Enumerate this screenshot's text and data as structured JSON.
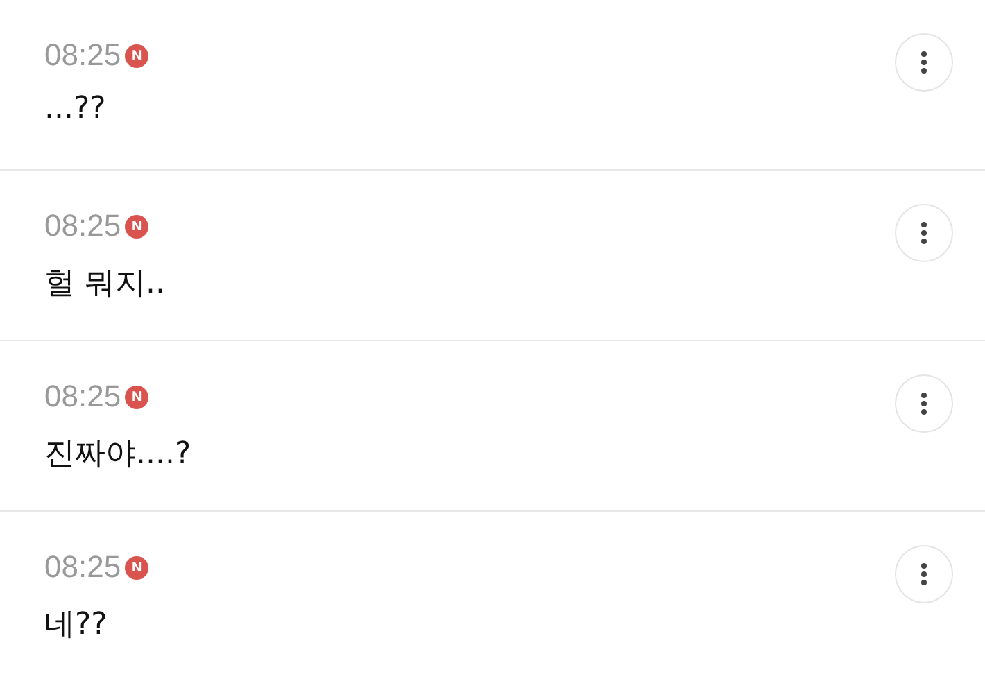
{
  "comments": [
    {
      "time": "08:25",
      "badge": "N",
      "text": "...??"
    },
    {
      "time": "08:25",
      "badge": "N",
      "text": "헐 뭐지.."
    },
    {
      "time": "08:25",
      "badge": "N",
      "text": "진짜야....?"
    },
    {
      "time": "08:25",
      "badge": "N",
      "text": "네??"
    }
  ]
}
